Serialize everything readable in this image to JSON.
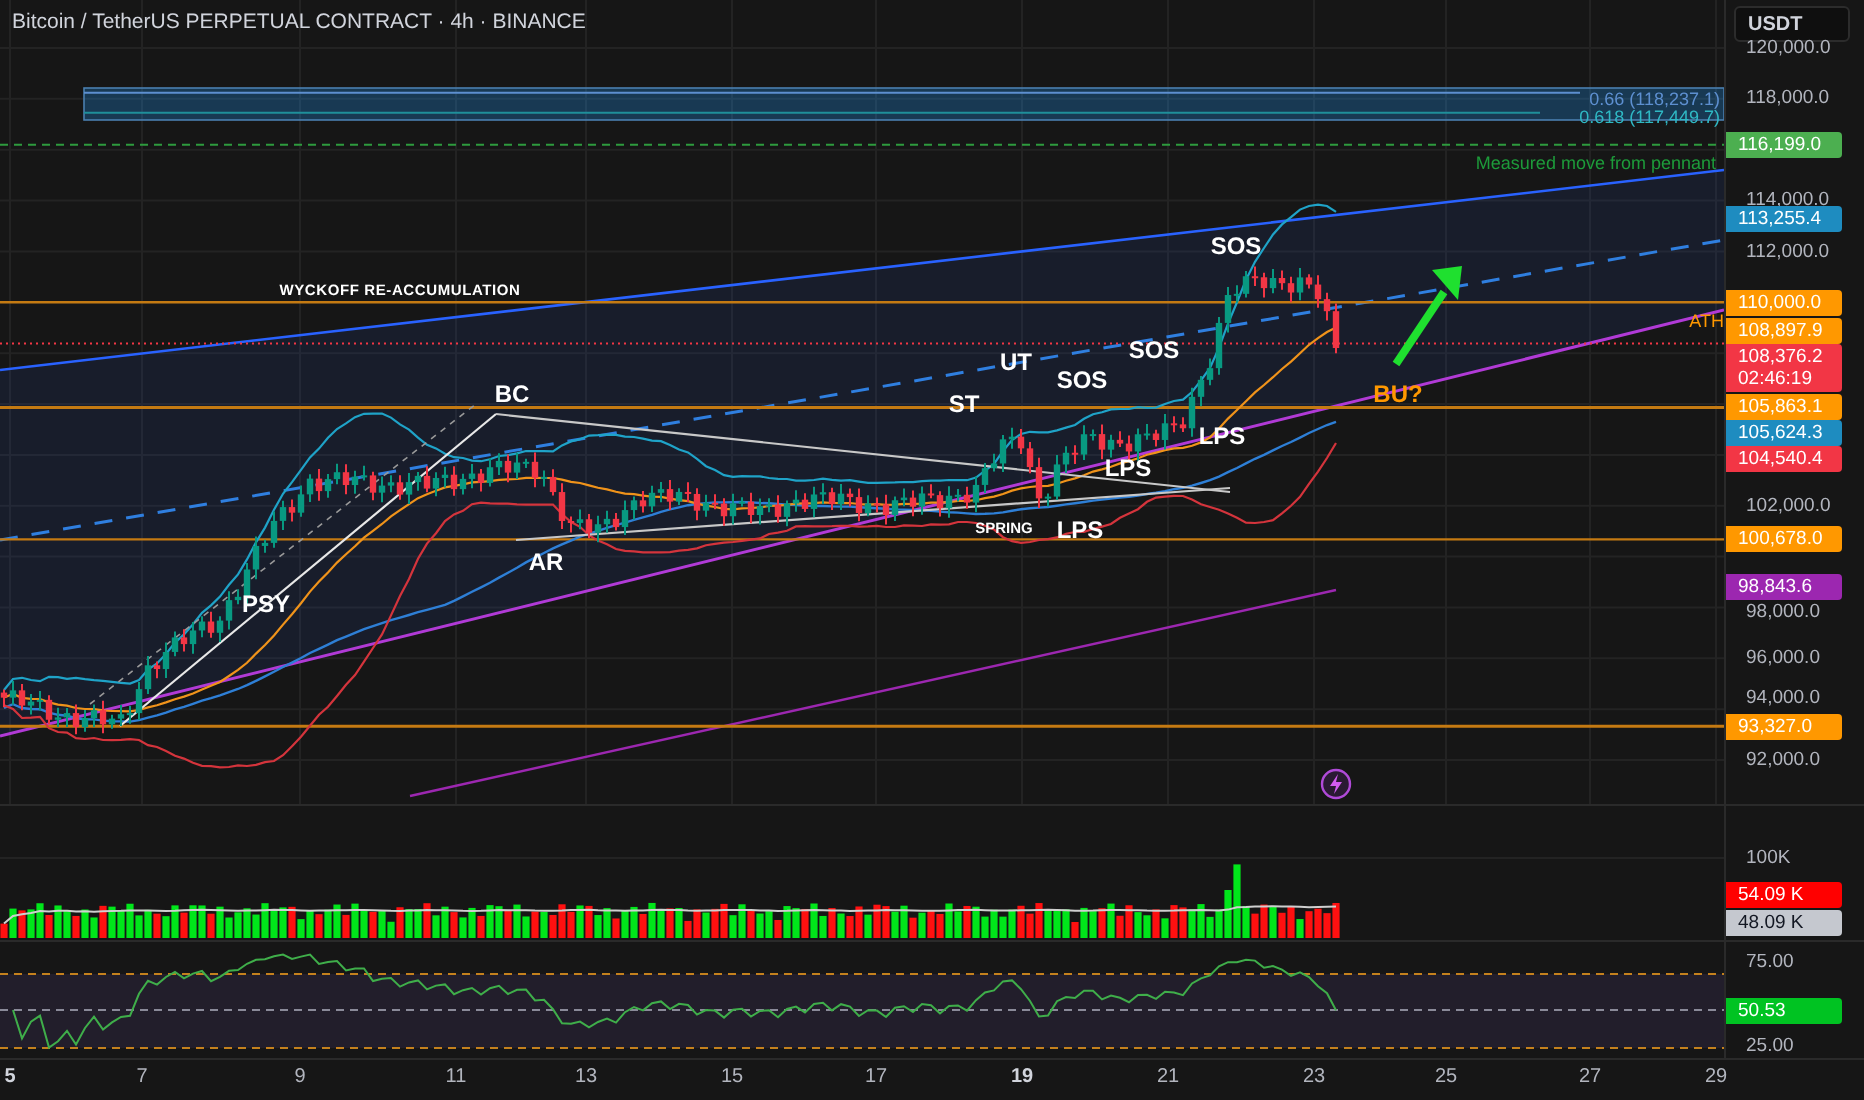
{
  "chart_header": {
    "title": "Bitcoin / TetherUS PERPETUAL CONTRACT · 4h · BINANCE"
  },
  "annotations": [
    {
      "kind": "heading",
      "text": "WYCKOFF RE-ACCUMULATION",
      "color": "#ffffff"
    },
    {
      "kind": "caption",
      "text": "0.66 (118,237.1)",
      "color": "#5d8fd0"
    },
    {
      "kind": "caption",
      "text": "0.618 (117,449.7)",
      "color": "#2fb8c4"
    },
    {
      "kind": "caption",
      "text": "Measured move from pennant",
      "color": "#1d9b3a"
    },
    {
      "kind": "caption",
      "text": "ATH",
      "color": "#ff9800"
    },
    {
      "kind": "label",
      "text": "BC",
      "color": "#ffffff"
    },
    {
      "kind": "label",
      "text": "PSY",
      "color": "#ffffff"
    },
    {
      "kind": "label",
      "text": "AR",
      "color": "#ffffff"
    },
    {
      "kind": "label",
      "text": "ST",
      "color": "#ffffff"
    },
    {
      "kind": "label",
      "text": "UT",
      "color": "#ffffff"
    },
    {
      "kind": "label",
      "text": "SOS",
      "color": "#ffffff"
    },
    {
      "kind": "label",
      "text": "SOS",
      "color": "#ffffff"
    },
    {
      "kind": "label",
      "text": "SOS",
      "color": "#ffffff"
    },
    {
      "kind": "label",
      "text": "LPS",
      "color": "#ffffff"
    },
    {
      "kind": "label",
      "text": "LPS",
      "color": "#ffffff"
    },
    {
      "kind": "note",
      "text": "SPRING",
      "color": "#ffffff"
    },
    {
      "kind": "label",
      "text": "LPS",
      "color": "#ffffff"
    },
    {
      "kind": "label",
      "text": "BU?",
      "color": "#ff9800"
    }
  ],
  "price_axis": {
    "currency": "USDT",
    "ticks": [
      "120,000.0",
      "118,000.0",
      "114,000.0",
      "112,000.0",
      "102,000.0",
      "98,000.0",
      "96,000.0",
      "94,000.0",
      "92,000.0"
    ],
    "tags": [
      {
        "text": "116,199.0",
        "color": "#4caf50"
      },
      {
        "text": "113,255.4",
        "color": "#1e8cc0"
      },
      {
        "text": "110,000.0",
        "color": "#ff9800"
      },
      {
        "text": "108,897.9",
        "color": "#ff9800"
      },
      {
        "text": "108,376.2",
        "sub": "02:46:19",
        "color": "#f23645"
      },
      {
        "text": "105,863.1",
        "color": "#ff9800"
      },
      {
        "text": "105,624.3",
        "color": "#1e8cc0"
      },
      {
        "text": "104,540.4",
        "color": "#f23645"
      },
      {
        "text": "100,678.0",
        "color": "#ff9800"
      },
      {
        "text": "98,843.6",
        "color": "#9c27b0"
      },
      {
        "text": "93,327.0",
        "color": "#ff9800"
      }
    ]
  },
  "volume_pane": {
    "ticks": [
      "100K"
    ],
    "tags": [
      {
        "text": "54.09 K",
        "color": "#ff0000"
      },
      {
        "text": "48.09 K",
        "color": "#c5c8cf"
      }
    ]
  },
  "rsi_pane": {
    "ticks": [
      "75.00",
      "25.00"
    ],
    "tags": [
      {
        "text": "50.53",
        "color": "#00c322"
      }
    ]
  },
  "time_axis": {
    "labels": [
      {
        "text": "5",
        "emphasized": true
      },
      {
        "text": "7",
        "emphasized": false
      },
      {
        "text": "9",
        "emphasized": false
      },
      {
        "text": "11",
        "emphasized": false
      },
      {
        "text": "13",
        "emphasized": false
      },
      {
        "text": "15",
        "emphasized": false
      },
      {
        "text": "17",
        "emphasized": false
      },
      {
        "text": "19",
        "emphasized": true
      },
      {
        "text": "21",
        "emphasized": false
      },
      {
        "text": "23",
        "emphasized": false
      },
      {
        "text": "25",
        "emphasized": false
      },
      {
        "text": "27",
        "emphasized": false
      },
      {
        "text": "29",
        "emphasized": false
      }
    ]
  }
}
